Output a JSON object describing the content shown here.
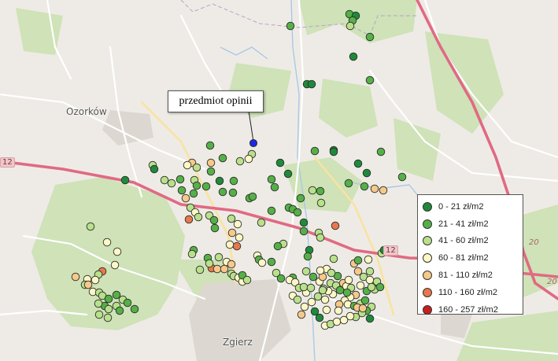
{
  "map": {
    "towns": [
      {
        "key": "ozorkow",
        "label": "Ozorków"
      },
      {
        "key": "zgierz",
        "label": "Zgierz"
      }
    ],
    "roads": {
      "shield_s14": "12",
      "shield_a2": "12",
      "num_1": "20",
      "num_2": "20"
    }
  },
  "callout": {
    "label": "przedmiot opinii"
  },
  "legend": {
    "items": [
      {
        "label": "0 - 21 zł/m2",
        "color": "#1e8a3a"
      },
      {
        "label": "21 - 41 zł/m2",
        "color": "#55b047"
      },
      {
        "label": "41 - 60 zł/m2",
        "color": "#b9e08a"
      },
      {
        "label": "60 - 81 zł/m2",
        "color": "#fbf8c6"
      },
      {
        "label": "81 - 110 zł/m2",
        "color": "#f6c98a"
      },
      {
        "label": "110 - 160 zł/m2",
        "color": "#e8784c"
      },
      {
        "label": "160 - 257 zł/m2",
        "color": "#c81e1e"
      }
    ]
  },
  "subject_marker_color": "#1a2be0"
}
